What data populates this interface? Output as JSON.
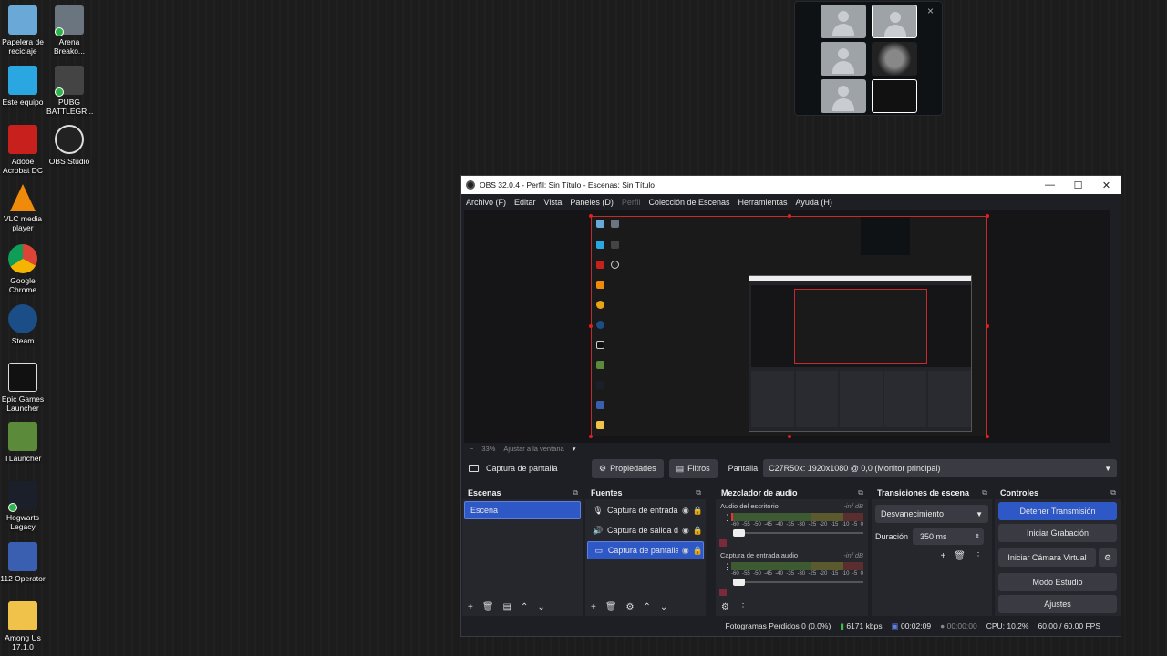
{
  "desktop_icons": [
    {
      "label": "Papelera de reciclaje",
      "icon": "recycle-bin-icon",
      "color": "#6aa8d8"
    },
    {
      "label": "Arena Breako...",
      "icon": "arena-breakout-icon",
      "color": "#6b7580"
    },
    {
      "label": "Este equipo",
      "icon": "this-pc-icon",
      "color": "#2aa7e0"
    },
    {
      "label": "PUBG BATTLEGR...",
      "icon": "pubg-icon",
      "color": "#444"
    },
    {
      "label": "Adobe Acrobat DC",
      "icon": "adobe-acrobat-icon",
      "color": "#c8201c"
    },
    {
      "label": "OBS Studio",
      "icon": "obs-icon",
      "color": "#222"
    },
    {
      "label": "VLC media player",
      "icon": "vlc-icon",
      "color": "#f08a0a"
    },
    {
      "label": "Google Chrome",
      "icon": "chrome-icon",
      "color": "#e8a317"
    },
    {
      "label": "Steam",
      "icon": "steam-icon",
      "color": "#1b4d86"
    },
    {
      "label": "Epic Games Launcher",
      "icon": "epic-games-icon",
      "color": "#111"
    },
    {
      "label": "TLauncher",
      "icon": "tlauncher-icon",
      "color": "#5a8a3a"
    },
    {
      "label": "Hogwarts Legacy",
      "icon": "hogwarts-icon",
      "color": "#1a1f2a"
    },
    {
      "label": "112 Operator",
      "icon": "112-operator-icon",
      "color": "#3a5fb0"
    },
    {
      "label": "Among Us 17.1.0",
      "icon": "folder-icon",
      "color": "#f0c24a"
    }
  ],
  "video_grid": {
    "close": "×"
  },
  "obs": {
    "title": "OBS 32.0.4 - Perfil: Sin Título - Escenas: Sin Título",
    "window_buttons": {
      "minimize": "—",
      "maximize": "☐",
      "close": "✕"
    },
    "menu": [
      "Archivo (F)",
      "Editar",
      "Vista",
      "Paneles (D)",
      "Perfil",
      "Colección de Escenas",
      "Herramientas",
      "Ayuda (H)"
    ],
    "menu_disabled": "Perfil",
    "zoom": {
      "minus": "−",
      "percent": "33%",
      "fit": "Ajustar a la ventana",
      "arrow": "▾"
    },
    "source_bar": {
      "source_name": "Captura de pantalla",
      "properties": "Propiedades",
      "filters": "Filtros",
      "display_label": "Pantalla",
      "display_value": "C27R50x: 1920x1080 @ 0,0 (Monitor principal)"
    },
    "scenes": {
      "title": "Escenas",
      "items": [
        "Escena"
      ]
    },
    "sources": {
      "title": "Fuentes",
      "items": [
        {
          "name": "Captura de entrada",
          "icon": "mic-icon",
          "glyph": "🎙"
        },
        {
          "name": "Captura de salida d",
          "icon": "speaker-icon",
          "glyph": "🔊"
        },
        {
          "name": "Captura de pantalla",
          "icon": "monitor-icon",
          "glyph": "▭"
        }
      ]
    },
    "mixer": {
      "title": "Mezclador de audio",
      "channels": [
        {
          "name": "Audio del escritorio",
          "db": "-inf dB"
        },
        {
          "name": "Captura de entrada audio",
          "db": "-inf dB"
        }
      ],
      "ticks": [
        "-60",
        "-55",
        "-50",
        "-45",
        "-40",
        "-35",
        "-30",
        "-25",
        "-20",
        "-15",
        "-10",
        "-5",
        "0"
      ]
    },
    "transitions": {
      "title": "Transiciones de escena",
      "transition": "Desvanecimiento",
      "duration_label": "Duración",
      "duration_value": "350 ms"
    },
    "controls": {
      "title": "Controles",
      "stop_stream": "Detener Transmisión",
      "start_recording": "Iniciar Grabación",
      "start_virtual_cam": "Iniciar Cámara Virtual",
      "studio_mode": "Modo Estudio",
      "settings": "Ajustes"
    },
    "status": {
      "dropped_frames": "Fotogramas Perdidos 0 (0.0%)",
      "bitrate": "6171 kbps",
      "stream_time": "00:02:09",
      "rec_time": "00:00:00",
      "cpu": "CPU: 10.2%",
      "fps": "60.00 / 60.00 FPS"
    },
    "accent": "#2f58c7"
  }
}
